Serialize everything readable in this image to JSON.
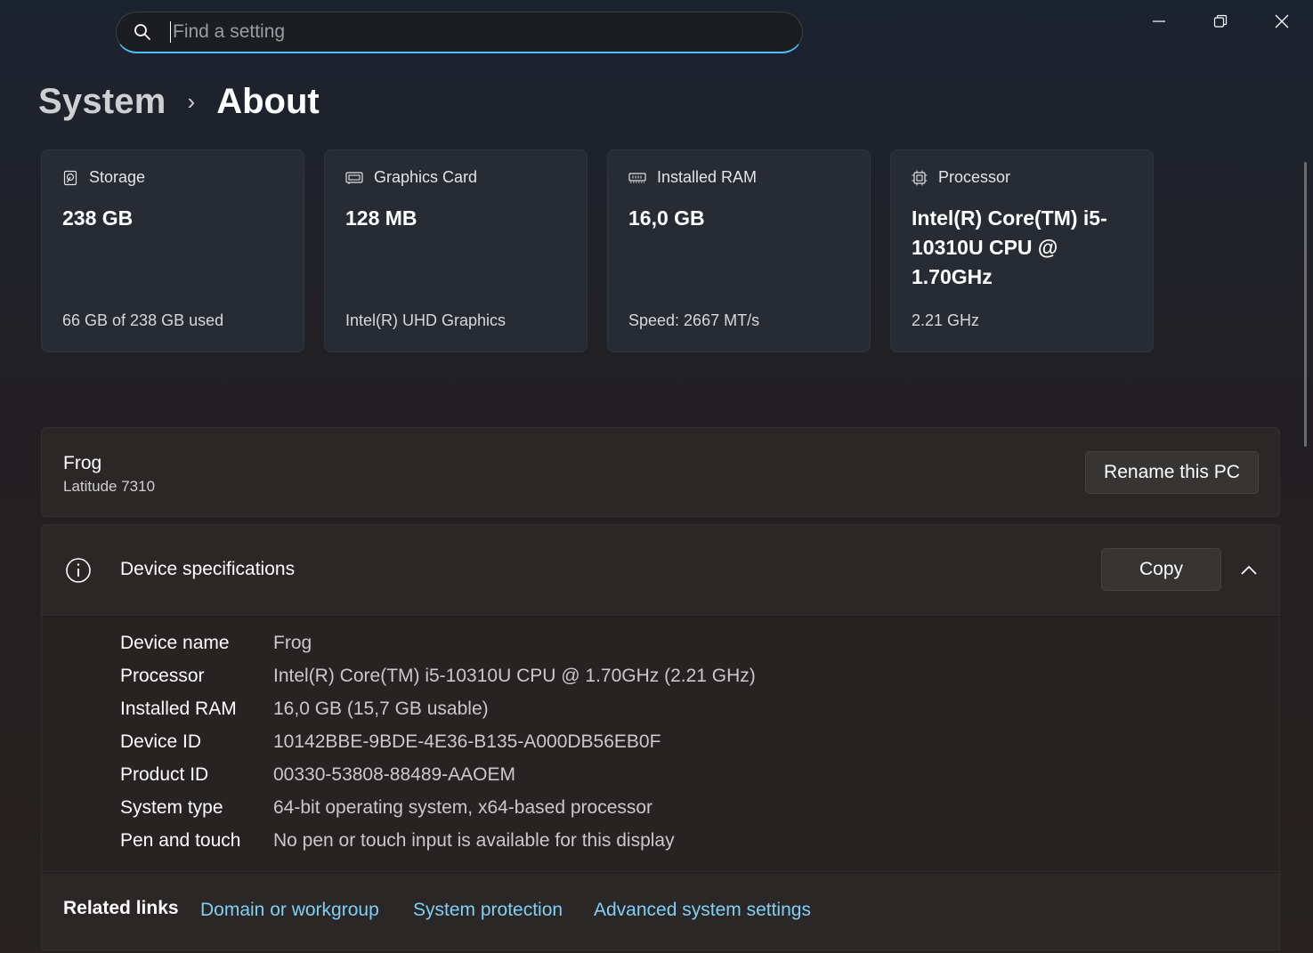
{
  "search": {
    "placeholder": "Find a setting"
  },
  "window": {
    "minimize_icon": "minimize-icon",
    "restore_icon": "restore-icon",
    "close_icon": "close-icon"
  },
  "breadcrumb": {
    "parent": "System",
    "separator": "›",
    "current": "About"
  },
  "cards": [
    {
      "icon": "storage-icon",
      "title": "Storage",
      "value": "238 GB",
      "sub": "66 GB of 238 GB used"
    },
    {
      "icon": "graphics-card-icon",
      "title": "Graphics Card",
      "value": "128 MB",
      "sub": "Intel(R) UHD Graphics"
    },
    {
      "icon": "ram-icon",
      "title": "Installed RAM",
      "value": "16,0 GB",
      "sub": "Speed: 2667 MT/s"
    },
    {
      "icon": "processor-icon",
      "title": "Processor",
      "value": "Intel(R) Core(TM) i5-10310U CPU @ 1.70GHz",
      "sub": "2.21 GHz"
    }
  ],
  "pc": {
    "name": "Frog",
    "model": "Latitude 7310",
    "rename_label": "Rename this PC"
  },
  "device_specs": {
    "title": "Device specifications",
    "copy_label": "Copy",
    "rows": [
      {
        "key": "Device name",
        "value": "Frog"
      },
      {
        "key": "Processor",
        "value": "Intel(R) Core(TM) i5-10310U CPU @ 1.70GHz (2.21 GHz)"
      },
      {
        "key": "Installed RAM",
        "value": "16,0 GB (15,7 GB usable)"
      },
      {
        "key": "Device ID",
        "value": "10142BBE-9BDE-4E36-B135-A000DB56EB0F"
      },
      {
        "key": "Product ID",
        "value": "00330-53808-88489-AAOEM"
      },
      {
        "key": "System type",
        "value": "64-bit operating system, x64-based processor"
      },
      {
        "key": "Pen and touch",
        "value": "No pen or touch input is available for this display"
      }
    ]
  },
  "related_links": {
    "label": "Related links",
    "links": [
      "Domain or workgroup",
      "System protection",
      "Advanced system settings"
    ]
  },
  "colors": {
    "accent": "#4cc2ff",
    "link": "#7fd0f5"
  }
}
